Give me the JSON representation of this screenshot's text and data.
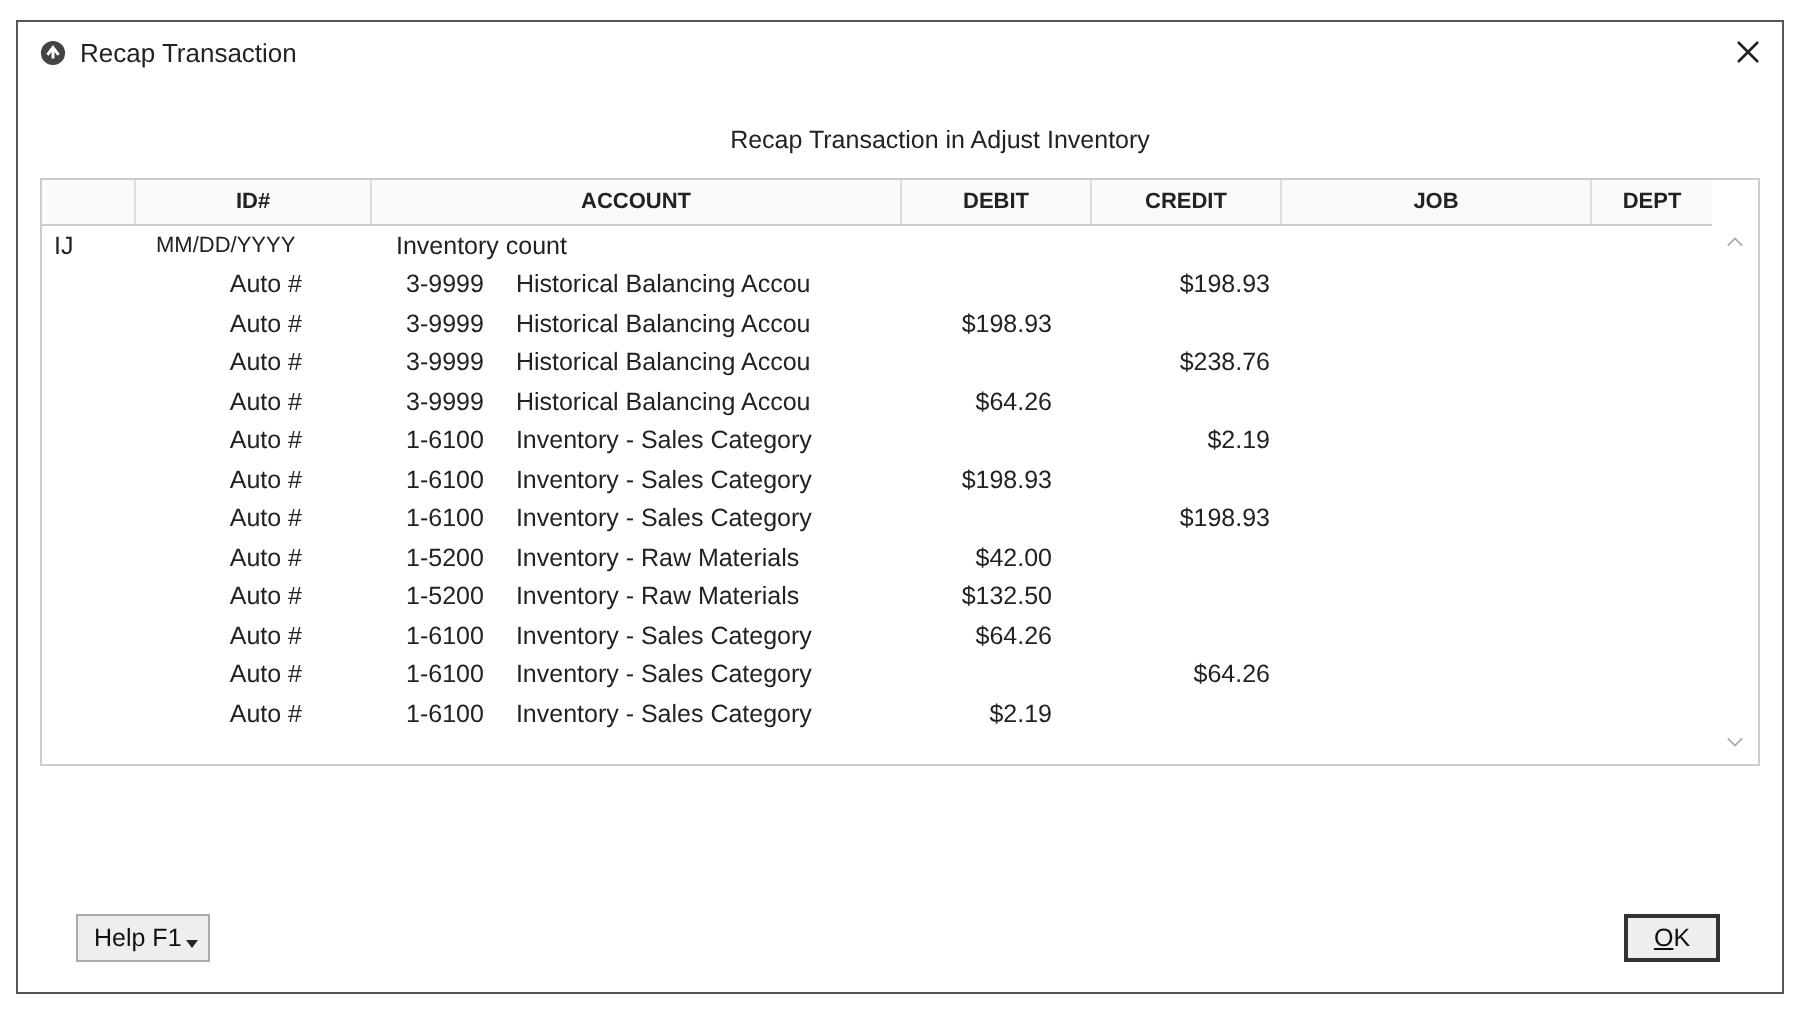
{
  "window": {
    "title": "Recap Transaction"
  },
  "heading": "Recap Transaction in Adjust Inventory",
  "table": {
    "columns": [
      "ID#",
      "ACCOUNT",
      "DEBIT",
      "CREDIT",
      "JOB",
      "DEPT"
    ],
    "header_row": {
      "type": "IJ",
      "date": "MM/DD/YYYY",
      "description": "Inventory count"
    },
    "rows": [
      {
        "id": "Auto #",
        "account_number": "3-9999",
        "account_name": "Historical Balancing Accou",
        "credit": "$198.93"
      },
      {
        "id": "Auto #",
        "account_number": "3-9999",
        "account_name": "Historical Balancing Accou",
        "debit": "$198.93"
      },
      {
        "id": "Auto #",
        "account_number": "3-9999",
        "account_name": "Historical Balancing Accou",
        "credit": "$238.76"
      },
      {
        "id": "Auto #",
        "account_number": "3-9999",
        "account_name": "Historical Balancing Accou",
        "debit": "$64.26"
      },
      {
        "id": "Auto #",
        "account_number": "1-6100",
        "account_name": "Inventory - Sales Category",
        "credit": "$2.19"
      },
      {
        "id": "Auto #",
        "account_number": "1-6100",
        "account_name": "Inventory - Sales Category",
        "debit": "$198.93"
      },
      {
        "id": "Auto #",
        "account_number": "1-6100",
        "account_name": "Inventory - Sales Category",
        "credit": "$198.93"
      },
      {
        "id": "Auto #",
        "account_number": "1-5200",
        "account_name": "Inventory - Raw Materials",
        "debit": "$42.00"
      },
      {
        "id": "Auto #",
        "account_number": "1-5200",
        "account_name": "Inventory - Raw Materials",
        "debit": "$132.50"
      },
      {
        "id": "Auto #",
        "account_number": "1-6100",
        "account_name": "Inventory - Sales Category",
        "debit": "$64.26"
      },
      {
        "id": "Auto #",
        "account_number": "1-6100",
        "account_name": "Inventory - Sales Category",
        "credit": "$64.26"
      },
      {
        "id": "Auto #",
        "account_number": "1-6100",
        "account_name": "Inventory - Sales Category",
        "debit": "$2.19"
      }
    ]
  },
  "buttons": {
    "help": "Help F1",
    "ok": "OK"
  }
}
